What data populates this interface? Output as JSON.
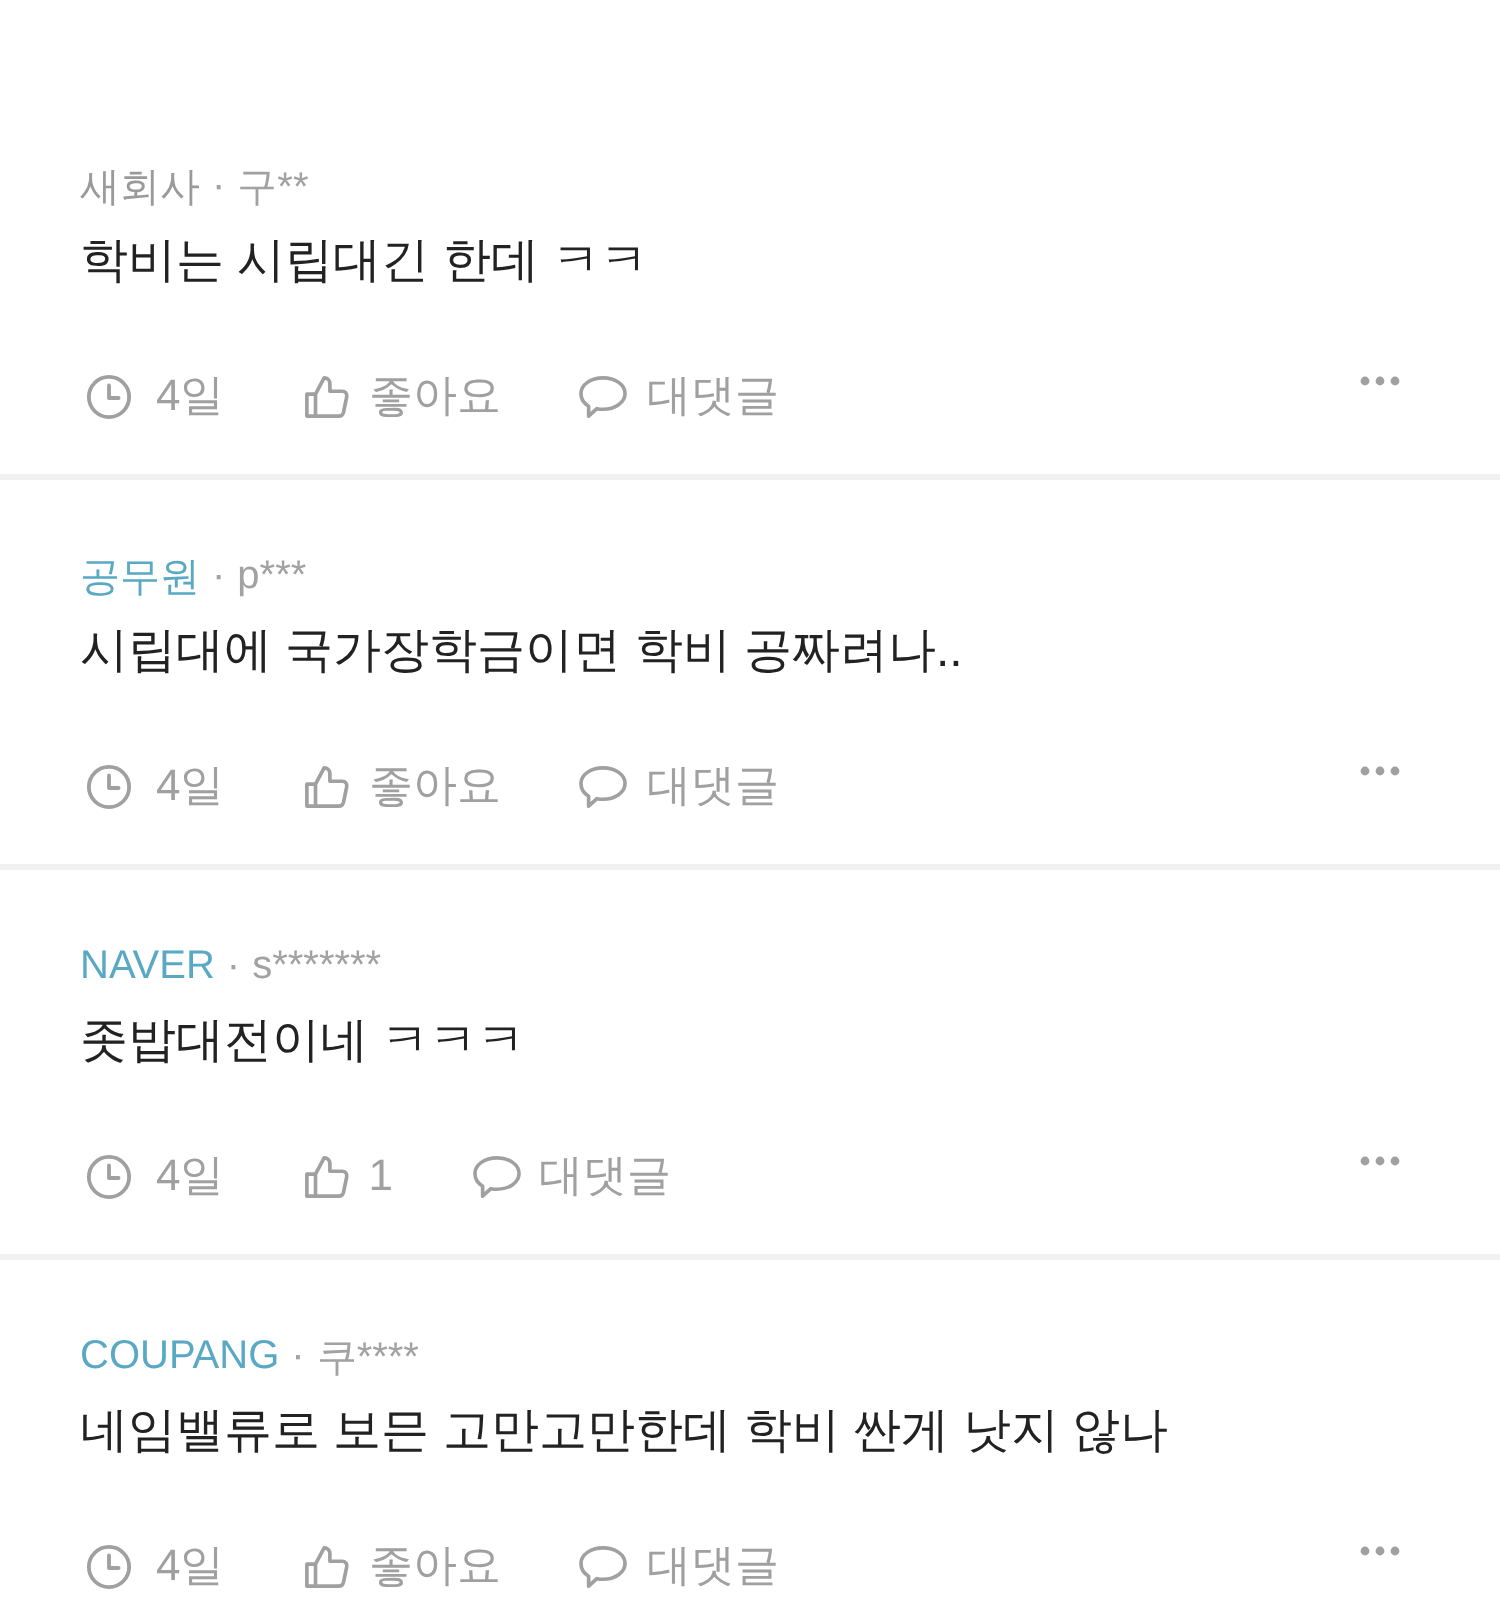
{
  "comments": [
    {
      "company": "새회사",
      "color": "#9a9a9a",
      "separator": "·",
      "author": "구**",
      "text": "학비는 시립대긴 한데 ㅋㅋ",
      "time": "4일",
      "likes": "좋아요",
      "reply": "대댓글"
    },
    {
      "company": "공무원",
      "color": "#5aa9c4",
      "separator": "·",
      "author": "p***",
      "text": "시립대에 국가장학금이면 학비 공짜려나..",
      "time": "4일",
      "likes": "좋아요",
      "reply": "대댓글"
    },
    {
      "company": "NAVER",
      "color": "#5aa9c4",
      "separator": "·",
      "author": "s*******",
      "text": "좃밥대전이네 ㅋㅋㅋ",
      "time": "4일",
      "likes": "1",
      "reply": "대댓글"
    },
    {
      "company": "COUPANG",
      "color": "#5aa9c4",
      "separator": "·",
      "author": "쿠****",
      "text": "네임밸류로 보믄 고만고만한데 학비 싼게 낫지 않나",
      "time": "4일",
      "likes": "좋아요",
      "reply": "대댓글"
    }
  ]
}
